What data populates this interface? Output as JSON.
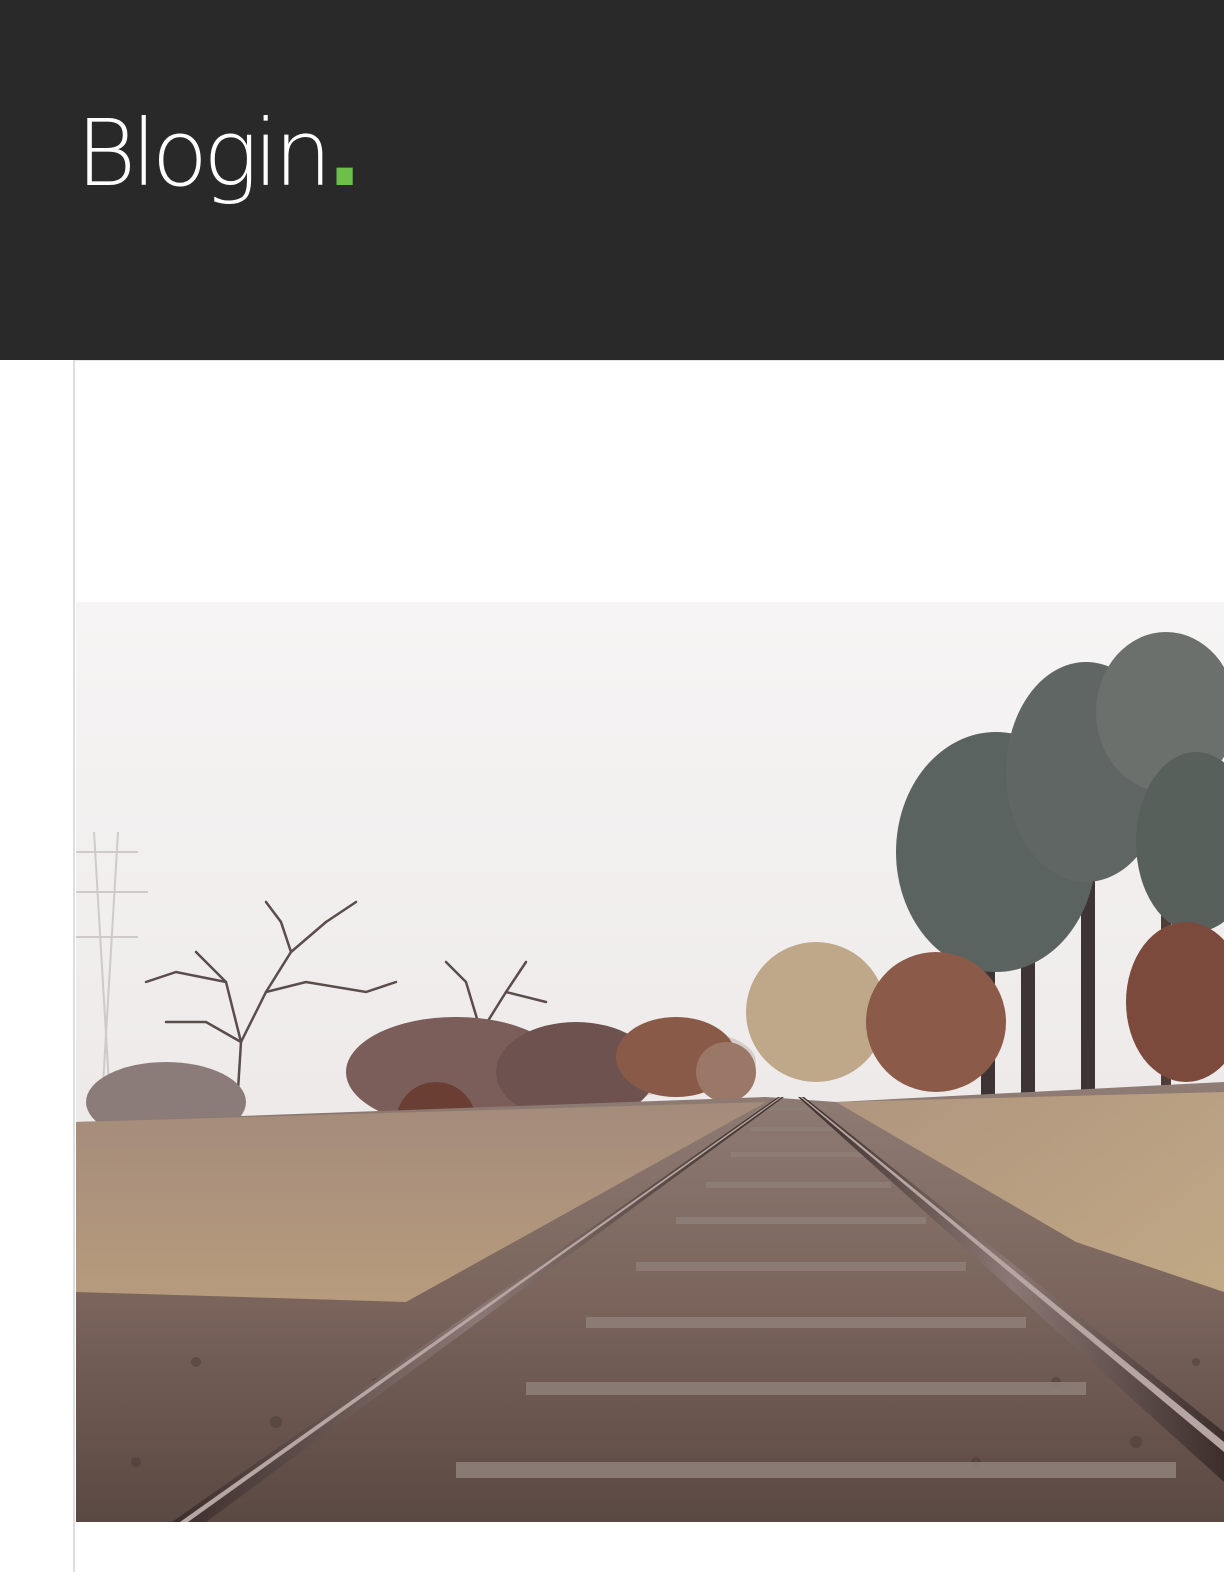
{
  "site": {
    "logo_text": "Blogin",
    "logo_dot": ".",
    "accent_color": "#6cc04a",
    "header_background": "#2a292a"
  },
  "featured_image": {
    "subject": "railway-tracks-photo-icon"
  }
}
